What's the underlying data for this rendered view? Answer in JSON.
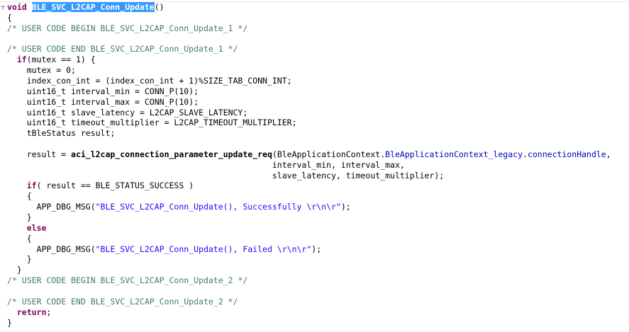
{
  "editor": {
    "lines": [
      {
        "segments": [
          {
            "t": "void",
            "c": "kw"
          },
          {
            "t": " ",
            "c": ""
          },
          {
            "t": "BLE_SVC_L2CAP_Conn_Update",
            "c": "sel"
          },
          {
            "t": "()",
            "c": ""
          }
        ]
      },
      {
        "segments": [
          {
            "t": "{",
            "c": ""
          }
        ]
      },
      {
        "segments": [
          {
            "t": "/* USER CODE BEGIN BLE_SVC_L2CAP_Conn_Update_1 */",
            "c": "cm"
          }
        ]
      },
      {
        "segments": [
          {
            "t": "",
            "c": ""
          }
        ]
      },
      {
        "segments": [
          {
            "t": "/* USER CODE END BLE_SVC_L2CAP_Conn_Update_1 */",
            "c": "cm"
          }
        ]
      },
      {
        "segments": [
          {
            "t": "  ",
            "c": ""
          },
          {
            "t": "if",
            "c": "kw"
          },
          {
            "t": "(mutex == 1) {",
            "c": ""
          }
        ]
      },
      {
        "segments": [
          {
            "t": "    mutex = 0;",
            "c": ""
          }
        ]
      },
      {
        "segments": [
          {
            "t": "    index_con_int = (index_con_int + 1)%SIZE_TAB_CONN_INT;",
            "c": ""
          }
        ]
      },
      {
        "segments": [
          {
            "t": "    uint16_t ",
            "c": ""
          },
          {
            "t": "interval_min",
            "c": "it"
          },
          {
            "t": " = CONN_P(10);",
            "c": ""
          }
        ]
      },
      {
        "segments": [
          {
            "t": "    uint16_t ",
            "c": ""
          },
          {
            "t": "interval_max",
            "c": "it"
          },
          {
            "t": " = CONN_P(10);",
            "c": ""
          }
        ]
      },
      {
        "segments": [
          {
            "t": "    uint16_t ",
            "c": ""
          },
          {
            "t": "slave_latency",
            "c": "it"
          },
          {
            "t": " = L2CAP_SLAVE_LATENCY;",
            "c": ""
          }
        ]
      },
      {
        "segments": [
          {
            "t": "    uint16_t ",
            "c": ""
          },
          {
            "t": "timeout_multiplier",
            "c": "it"
          },
          {
            "t": " = L2CAP_TIMEOUT_MULTIPLIER;",
            "c": ""
          }
        ]
      },
      {
        "segments": [
          {
            "t": "    tBleStatus ",
            "c": ""
          },
          {
            "t": "result",
            "c": "it"
          },
          {
            "t": ";",
            "c": ""
          }
        ]
      },
      {
        "segments": [
          {
            "t": "",
            "c": ""
          }
        ]
      },
      {
        "segments": [
          {
            "t": "    result = ",
            "c": ""
          },
          {
            "t": "aci_l2cap_connection_parameter_update_req",
            "c": "fn"
          },
          {
            "t": "(BleApplicationContext.",
            "c": ""
          },
          {
            "t": "BleApplicationContext_legacy",
            "c": "field"
          },
          {
            "t": ".",
            "c": ""
          },
          {
            "t": "connectionHandle",
            "c": "field"
          },
          {
            "t": ",",
            "c": ""
          }
        ]
      },
      {
        "segments": [
          {
            "t": "                                                      interval_min, interval_max,",
            "c": ""
          }
        ]
      },
      {
        "segments": [
          {
            "t": "                                                      slave_latency, timeout_multiplier);",
            "c": ""
          }
        ]
      },
      {
        "segments": [
          {
            "t": "    ",
            "c": ""
          },
          {
            "t": "if",
            "c": "kw"
          },
          {
            "t": "( result == BLE_STATUS_SUCCESS )",
            "c": ""
          }
        ]
      },
      {
        "segments": [
          {
            "t": "    {",
            "c": ""
          }
        ]
      },
      {
        "segments": [
          {
            "t": "      APP_DBG_MSG(",
            "c": ""
          },
          {
            "t": "\"BLE_SVC_L2CAP_Conn_Update(), Successfully \\r\\n\\r\"",
            "c": "str"
          },
          {
            "t": ");",
            "c": ""
          }
        ]
      },
      {
        "segments": [
          {
            "t": "    }",
            "c": ""
          }
        ]
      },
      {
        "segments": [
          {
            "t": "    ",
            "c": ""
          },
          {
            "t": "else",
            "c": "kw"
          }
        ]
      },
      {
        "segments": [
          {
            "t": "    {",
            "c": ""
          }
        ]
      },
      {
        "segments": [
          {
            "t": "      APP_DBG_MSG(",
            "c": ""
          },
          {
            "t": "\"BLE_SVC_L2CAP_Conn_Update(), Failed \\r\\n\\r\"",
            "c": "str"
          },
          {
            "t": ");",
            "c": ""
          }
        ]
      },
      {
        "segments": [
          {
            "t": "    }",
            "c": ""
          }
        ]
      },
      {
        "segments": [
          {
            "t": "  }",
            "c": ""
          }
        ]
      },
      {
        "segments": [
          {
            "t": "/* USER CODE BEGIN BLE_SVC_L2CAP_Conn_Update_2 */",
            "c": "cm"
          }
        ]
      },
      {
        "segments": [
          {
            "t": "",
            "c": ""
          }
        ]
      },
      {
        "segments": [
          {
            "t": "/* USER CODE END BLE_SVC_L2CAP_Conn_Update_2 */",
            "c": "cm"
          }
        ]
      },
      {
        "segments": [
          {
            "t": "  ",
            "c": ""
          },
          {
            "t": "return",
            "c": "kw"
          },
          {
            "t": ";",
            "c": ""
          }
        ]
      },
      {
        "segments": [
          {
            "t": "}",
            "c": ""
          }
        ]
      }
    ],
    "colors": {
      "keyword": "#7f0055",
      "comment": "#3f7f5f",
      "string": "#2a00ff",
      "field": "#0000c0",
      "selection": "#3399ff"
    },
    "gutter": {
      "fold_icon": "collapse-minus-icon"
    }
  }
}
